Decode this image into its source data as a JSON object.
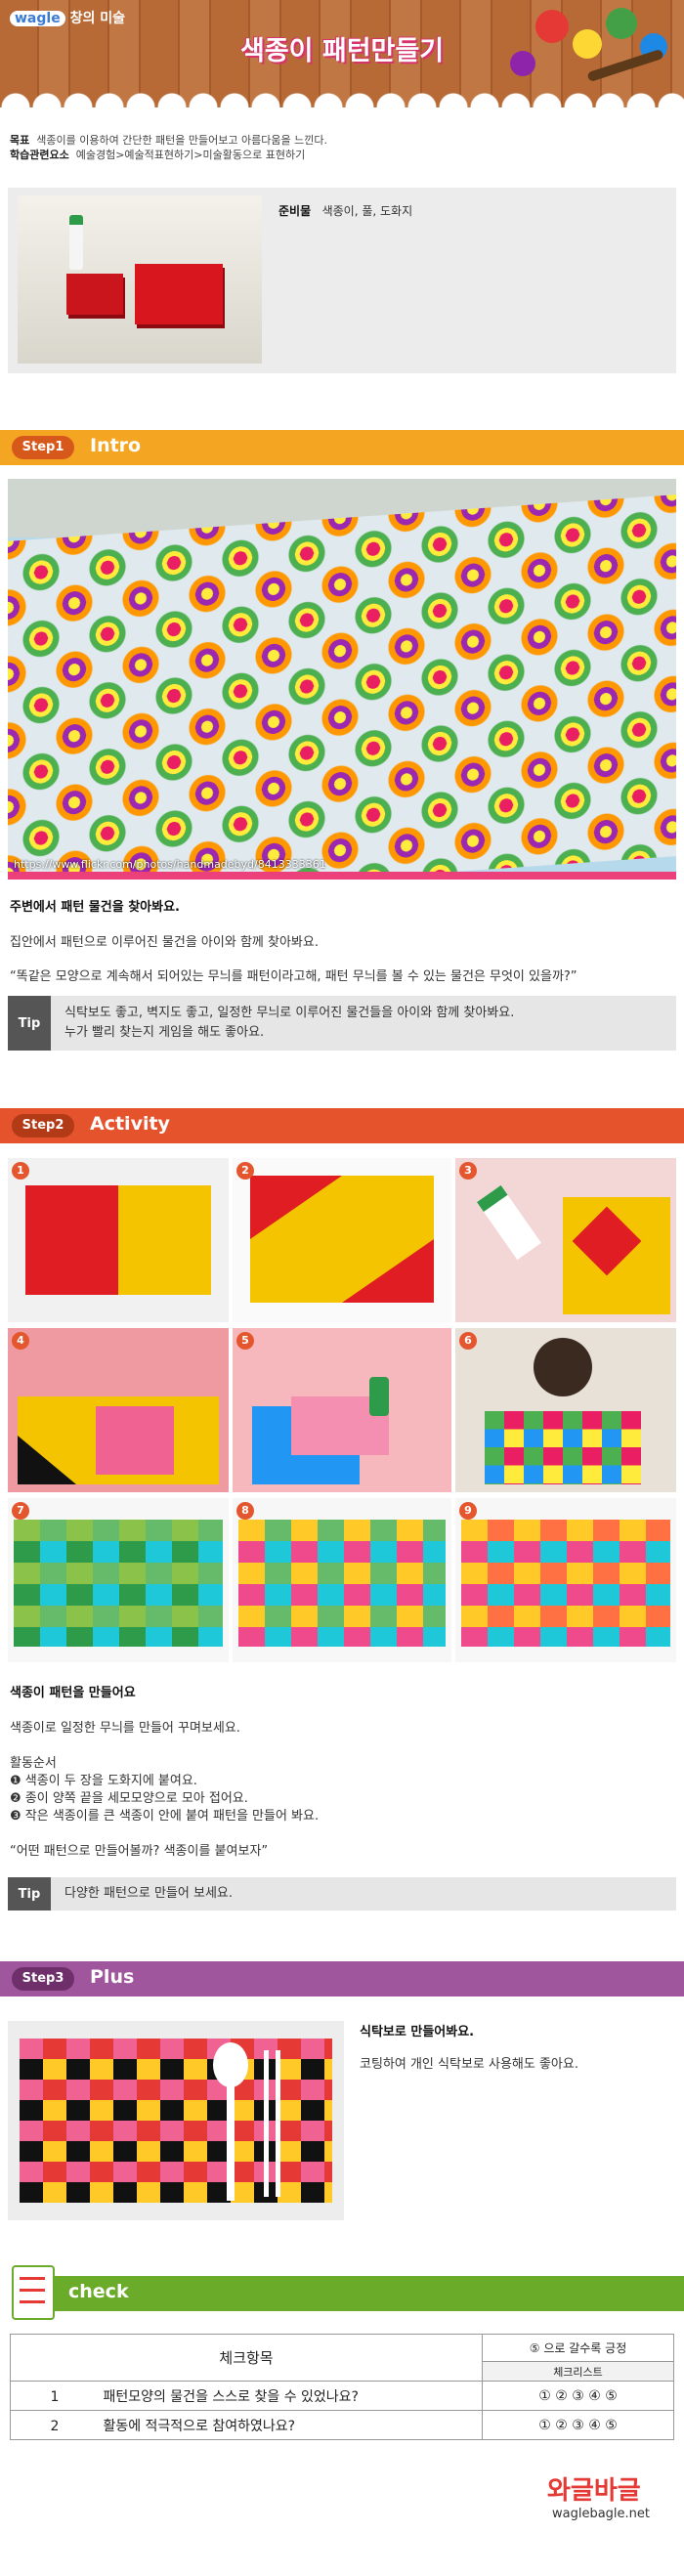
{
  "header": {
    "brand_logo": "wagle",
    "brand_text": "창의 미술",
    "title": "색종이 패턴만들기"
  },
  "intro": {
    "goal_label": "목표",
    "goal_text": "색종이를 이용하여 간단한 패턴을 만들어보고 아름다움을 느낀다.",
    "elements_label": "학습관련요소",
    "elements_text": "예술경험>예술적표현하기>미술활동으로 표현하기",
    "prep_label": "준비물",
    "prep_text": "색종이, 풀, 도화지"
  },
  "step1": {
    "pill": "Step1",
    "title": "Intro",
    "color": "#f4a623",
    "pill_color": "#d6581a",
    "photo_credit": "https://www.flickr.com/photos/handmadebyd/8413333361",
    "heading": "주변에서 패턴 물건을 찾아봐요.",
    "line1": "집안에서 패턴으로 이루어진 물건을 아이와 함께 찾아봐요.",
    "line2": "“똑같은 모양으로 계속해서 되어있는 무늬를 패턴이라고해, 패턴 무늬를 볼 수 있는 물건은 무엇이 있을까?”",
    "tip_label": "Tip",
    "tip_line1": "식탁보도 좋고, 벽지도 좋고, 일정한 무늬로 이루어진 물건들을 아이와 함께 찾아봐요.",
    "tip_line2": "누가 빨리 찾는지 게임을 해도 좋아요."
  },
  "step2": {
    "pill": "Step2",
    "title": "Activity",
    "color": "#e5532d",
    "pill_color": "#b23a16",
    "photos": [
      "1",
      "2",
      "3",
      "4",
      "5",
      "6",
      "7",
      "8",
      "9"
    ],
    "heading": "색종이 패턴을 만들어요",
    "line1": "색종이로 일정한 무늬를 만들어 꾸며보세요.",
    "order_label": "활동순서",
    "steps": [
      "❶ 색종이 두 장을 도화지에 붙여요.",
      "❷ 종이 양쪽 끝을 세모모양으로 모아 접어요.",
      "❸ 작은 색종이를 큰 색종이 안에 붙여 패턴을 만들어 봐요."
    ],
    "quote": "“어떤 패턴으로 만들어볼까? 색종이를 붙여보자”",
    "tip_label": "Tip",
    "tip_line1": "다양한 패턴으로 만들어 보세요."
  },
  "step3": {
    "pill": "Step3",
    "title": "Plus",
    "color": "#a0569d",
    "pill_color": "#6e2f6b",
    "heading": "식탁보로 만들어봐요.",
    "line1": "코팅하여 개인 식탁보로 사용해도 좋아요."
  },
  "check": {
    "title": "check",
    "color": "#6aab2a",
    "col_item": "체크항목",
    "col_scale": "⑤ 으로 갈수록 긍정",
    "col_list": "체크리스트",
    "rows": [
      {
        "no": "1",
        "item": "패턴모양의 물건을 스스로 찾을 수 있었나요?",
        "scale": "① ② ③ ④ ⑤"
      },
      {
        "no": "2",
        "item": "활동에 적극적으로 참여하였나요?",
        "scale": "① ② ③ ④ ⑤"
      }
    ]
  },
  "footer": {
    "logo": "와글바글",
    "site": "waglebagle.net"
  }
}
